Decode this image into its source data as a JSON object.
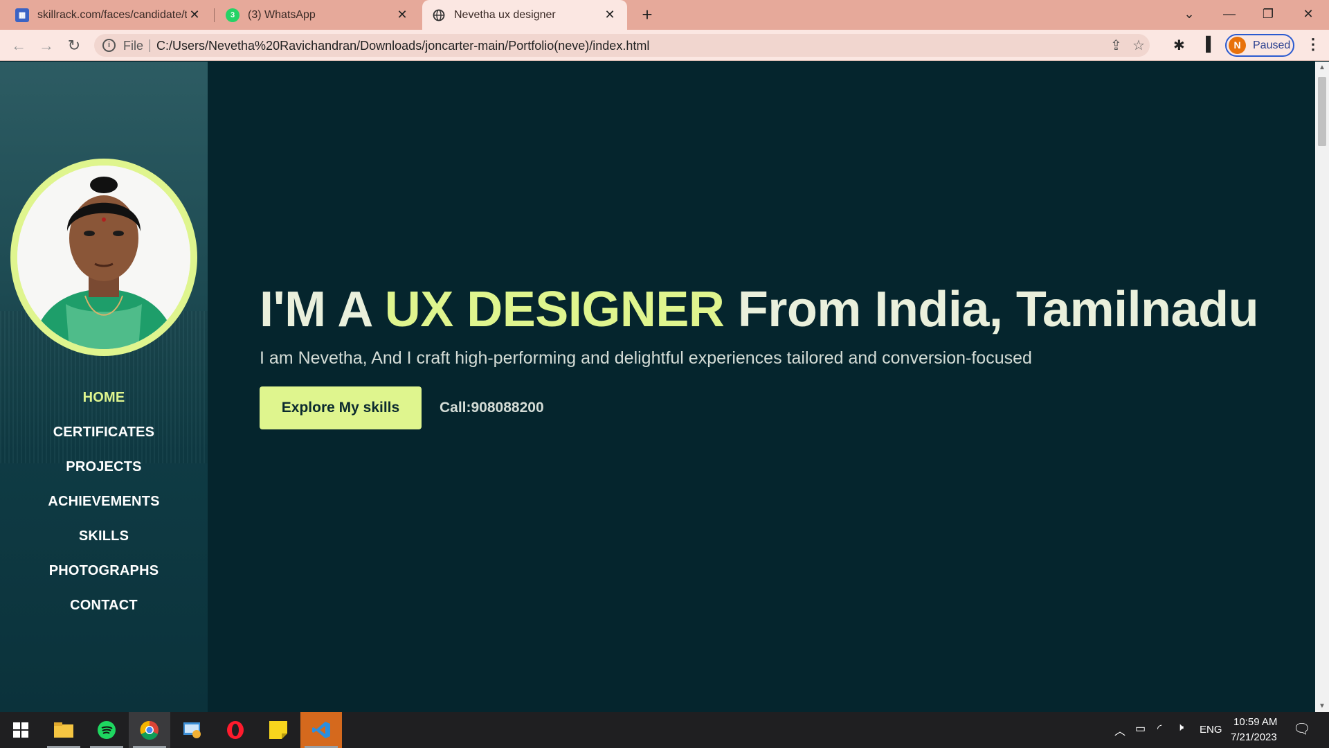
{
  "browser": {
    "tabs": [
      {
        "title": "skillrack.com/faces/candidate/tra",
        "favicon": "skillrack-favicon"
      },
      {
        "title": "(3) WhatsApp",
        "favicon": "whatsapp-favicon",
        "badge": "3"
      },
      {
        "title": "Nevetha ux designer",
        "favicon": "globe-favicon",
        "active": true
      }
    ],
    "address": {
      "scheme_label": "File",
      "url": "C:/Users/Nevetha%20Ravichandran/Downloads/joncarter-main/Portfolio(neve)/index.html"
    },
    "profile": {
      "initial": "N",
      "label": "Paused"
    }
  },
  "page": {
    "nav": [
      {
        "label": "HOME",
        "active": true
      },
      {
        "label": "CERTIFICATES"
      },
      {
        "label": "PROJECTS"
      },
      {
        "label": "ACHIEVEMENTS"
      },
      {
        "label": "SKILLS"
      },
      {
        "label": "PHOTOGRAPHS"
      },
      {
        "label": "CONTACT"
      }
    ],
    "hero": {
      "title_pre": "I'M A ",
      "title_highlight": "UX DESIGNER",
      "title_post": " From India, Tamilnadu",
      "subtitle": "I am Nevetha, And I craft high-performing and delightful experiences tailored and conversion-focused",
      "cta_label": "Explore My skills",
      "call_text": "Call:908088200"
    }
  },
  "taskbar": {
    "apps": [
      "windows-start",
      "file-explorer",
      "spotify",
      "chrome",
      "control-panel",
      "opera",
      "sticky-notes",
      "vs-code"
    ],
    "tray": {
      "language": "ENG",
      "time": "10:59 AM",
      "date": "7/21/2023"
    }
  },
  "colors": {
    "accent": "#dff58e",
    "page_bg": "#05252d",
    "chrome_tabbar": "#e6a99a"
  }
}
